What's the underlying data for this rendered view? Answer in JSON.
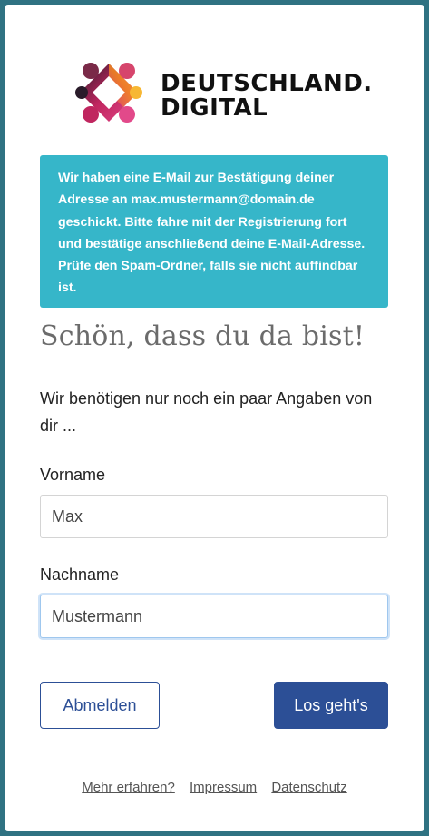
{
  "brand": {
    "line1": "DEUTSCHLAND.",
    "line2": "DIGITAL",
    "colors": [
      "#2a1b2a",
      "#c0265f",
      "#e2498a",
      "#f58a1f",
      "#f7b733"
    ]
  },
  "alert": {
    "text": "Wir haben eine E-Mail zur Bestätigung deiner Adresse an max.mustermann@domain.de geschickt. Bitte fahre mit der Registrierung fort und bestätige anschließend deine E-Mail-Adresse. Prüfe den Spam-Ordner, falls sie nicht auffindbar ist."
  },
  "heading": "Schön, dass du da bist!",
  "intro": "Wir benötigen nur noch ein paar Angaben von dir ...",
  "form": {
    "first_name_label": "Vorname",
    "first_name_value": "Max",
    "last_name_label": "Nachname",
    "last_name_value": "Mustermann"
  },
  "buttons": {
    "logout": "Abmelden",
    "submit": "Los geht's"
  },
  "footer": {
    "more": "Mehr erfahren?",
    "imprint": "Impressum",
    "privacy": "Datenschutz"
  },
  "colors": {
    "background": "#2f7282",
    "alert": "#36b6c9",
    "primary": "#2c4f96"
  }
}
